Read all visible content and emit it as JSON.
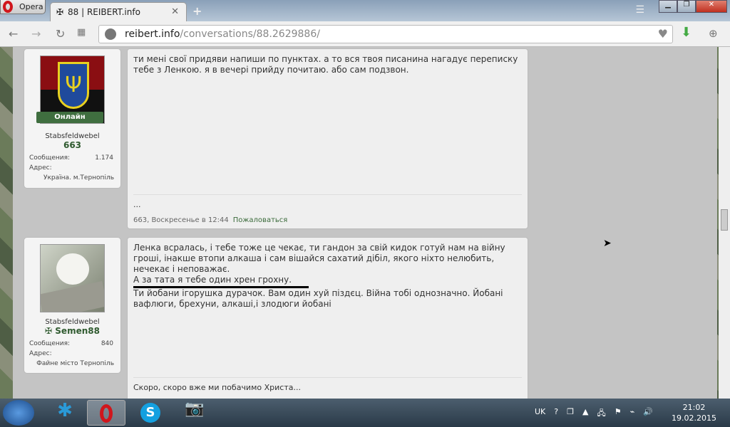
{
  "browser": {
    "app_label": "Opera",
    "tab_title": "88 | REIBERT.info",
    "url_host": "reibert.info",
    "url_path": "/conversations/88.2629886/"
  },
  "posts": [
    {
      "online_label": "Онлайн",
      "rank": "Stabsfeldwebel",
      "username": "663",
      "messages_label": "Сообщения:",
      "messages_count": "1.174",
      "address_label": "Адрес:",
      "address": "Україна. м.Тернопіль",
      "text": "ти мені свої придяви напиши по пунктах. а то вся твоя писанина нагадує переписку тебе з Ленкою. я в вечері прийду почитаю. або сам подзвон.",
      "signature": "...",
      "meta": "663, Воскресенье в 12:44",
      "report": "Пожаловаться"
    },
    {
      "rank": "Stabsfeldwebel",
      "username": "Semen88",
      "messages_label": "Сообщения:",
      "messages_count": "840",
      "address_label": "Адрес:",
      "address": "Файне місто Тернопіль",
      "text_1": "Ленка всралась, і тебе тоже це чекає, ти гандон за свій кидок готуй нам на війну гроші, інакше втопи алкаша і сам вішайся сахатий дібіл, якого ніхто нелюбить, нечекає і неповажає.",
      "text_2": "А за тата я тебе один хрен грохну.",
      "text_3": "Ти йобани ігорушка дурачок. Вам один хуй піздєц. Війна тобі однозначно. Йобані вафлюги, брехуни, алкаші,і злодюги йобані",
      "signature": "Скоро, скоро вже ми побачимо Христа..."
    }
  ],
  "tray": {
    "lang": "UK",
    "time": "21:02",
    "date": "19.02.2015"
  }
}
